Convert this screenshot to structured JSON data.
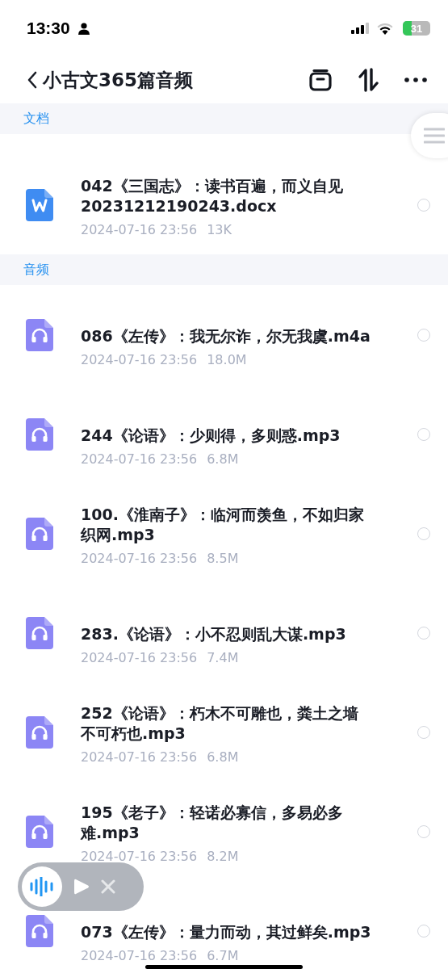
{
  "status_bar": {
    "time": "13:30",
    "battery": "31"
  },
  "nav": {
    "title": "小古文365篇音频"
  },
  "sections": [
    {
      "title": "文档",
      "items": [
        {
          "kind": "doc",
          "name": "042《三国志》：读书百遍，而义自见20231212190243.docx",
          "date": "2024-07-16 23:56",
          "size": "13K",
          "selected": false
        }
      ]
    },
    {
      "title": "音频",
      "items": [
        {
          "kind": "audio",
          "name": "086《左传》：我无尔诈，尔无我虞.m4a",
          "date": "2024-07-16 23:56",
          "size": "18.0M",
          "selected": false
        },
        {
          "kind": "audio",
          "name": "244《论语》：少则得，多则惑.mp3",
          "date": "2024-07-16 23:56",
          "size": "6.8M",
          "selected": false
        },
        {
          "kind": "audio",
          "name": "100.《淮南子》：临河而羡鱼，不如归家织网.mp3",
          "date": "2024-07-16 23:56",
          "size": "8.5M",
          "selected": false
        },
        {
          "kind": "audio",
          "name": "283.《论语》：小不忍则乱大谋.mp3",
          "date": "2024-07-16 23:56",
          "size": "7.4M",
          "selected": false
        },
        {
          "kind": "audio",
          "name": "252《论语》：朽木不可雕也，粪土之墙不可朽也.mp3",
          "date": "2024-07-16 23:56",
          "size": "6.8M",
          "selected": false
        },
        {
          "kind": "audio",
          "name": "195《老子》：轻诺必寡信，多易必多难.mp3",
          "date": "2024-07-16 23:56",
          "size": "8.2M",
          "selected": false
        },
        {
          "kind": "audio",
          "name": "073《左传》：量力而动，其过鲜矣.mp3",
          "date": "2024-07-16 23:56",
          "size": "6.7M",
          "selected": false
        }
      ]
    }
  ]
}
